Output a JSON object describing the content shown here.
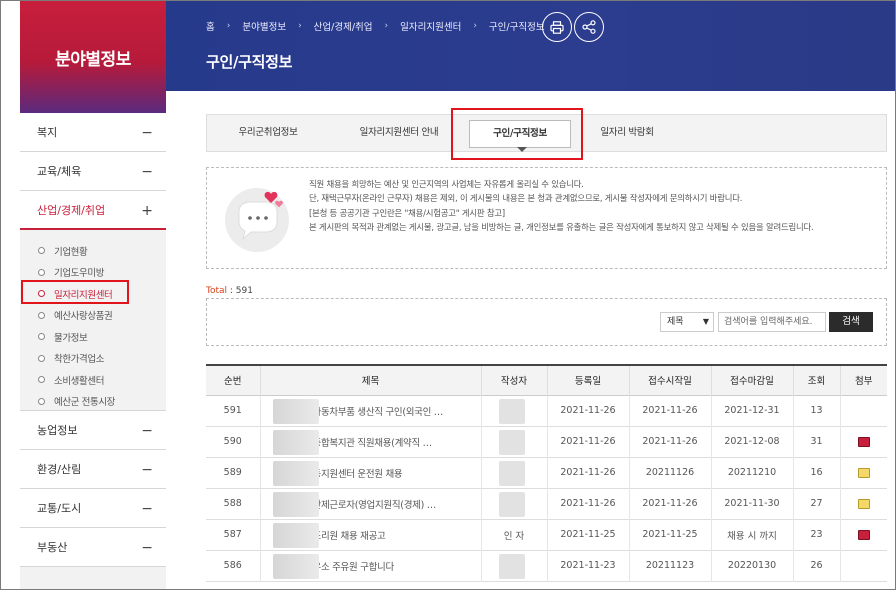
{
  "sidebar": {
    "title": "분야별정보",
    "items": [
      {
        "label": "복지",
        "ctrl": "−"
      },
      {
        "label": "교육/체육",
        "ctrl": "−"
      },
      {
        "label": "산업/경제/취업",
        "ctrl": "+"
      }
    ],
    "subitems": [
      "기업현황",
      "기업도우미방",
      "일자리지원센터",
      "예산사랑상품권",
      "물가정보",
      "착한가격업소",
      "소비생활센터",
      "예산군 전통시장"
    ],
    "items_after": [
      {
        "label": "농업정보",
        "ctrl": "−"
      },
      {
        "label": "환경/산림",
        "ctrl": "−"
      },
      {
        "label": "교통/도시",
        "ctrl": "−"
      },
      {
        "label": "부동산",
        "ctrl": "−"
      }
    ]
  },
  "header": {
    "breadcrumb": [
      "홈",
      "분야별정보",
      "산업/경제/취업",
      "일자리지원센터",
      "구인/구직정보"
    ],
    "breadcrumb_sep": "›",
    "page_title": "구인/구직정보"
  },
  "tabs": [
    "우리군취업정보",
    "일자리지원센터 안내",
    "구인/구직정보",
    "일자리 박람회"
  ],
  "notice": {
    "lines": [
      "직원 채용을 희망하는 예산 및 인근지역의 사업체는 자유롭게 올리실 수 있습니다.",
      "단, 재택근무자(온라인 근무자) 채용은 제외, 이 게시물의 내용은 본 청과 관계없으므로, 게시물 작성자에게 문의하시기 바랍니다.",
      "[본청 등 공공기관 구인란은 \"채용/시험공고\" 게시판 참고]",
      "본 게시판의 목적과 관계없는 게시물, 광고글, 남을 비방하는 글, 개인정보를 유출하는 글은 작성자에게 통보하지 않고 삭제될 수 있음을 알려드립니다."
    ]
  },
  "total": {
    "label": "Total",
    "value": ": 591"
  },
  "search": {
    "field": "제목",
    "placeholder": "검색어를 입력해주세요.",
    "button": "검색"
  },
  "table": {
    "headers": [
      "순번",
      "제목",
      "작성자",
      "등록일",
      "접수시작일",
      "접수마감일",
      "조회",
      "첨부"
    ],
    "rows": [
      {
        "no": "591",
        "title": "자동차부품 생산직 구인(외국인 …",
        "author": "",
        "reg": "2021-11-26",
        "start": "2021-11-26",
        "end": "2021-12-31",
        "views": "13",
        "attach": ""
      },
      {
        "no": "590",
        "title": "종합복지관 직원채용(계약직 …",
        "author": "",
        "reg": "2021-11-26",
        "start": "2021-11-26",
        "end": "2021-12-08",
        "views": "31",
        "attach": "pdf"
      },
      {
        "no": "589",
        "title": "동지원센터 운전원 채용",
        "author": "",
        "reg": "2021-11-26",
        "start": "20211126",
        "end": "20211210",
        "views": "16",
        "attach": "file"
      },
      {
        "no": "588",
        "title": "간제근로자(영업지원직(경제) …",
        "author": "",
        "reg": "2021-11-26",
        "start": "2021-11-26",
        "end": "2021-11-30",
        "views": "27",
        "attach": "file"
      },
      {
        "no": "587",
        "title": "조리원 채용 재공고",
        "author": "인 자",
        "reg": "2021-11-25",
        "start": "2021-11-25",
        "end": "채용 시 까지",
        "views": "23",
        "attach": "pdf"
      },
      {
        "no": "586",
        "title": "유소 주유원 구합니다",
        "author": "",
        "reg": "2021-11-23",
        "start": "20211123",
        "end": "20220130",
        "views": "26",
        "attach": ""
      }
    ]
  },
  "colors": {
    "accent_red": "#c8203c",
    "banner_blue": "#2a3a8a",
    "highlight_box": "#e1141c"
  }
}
